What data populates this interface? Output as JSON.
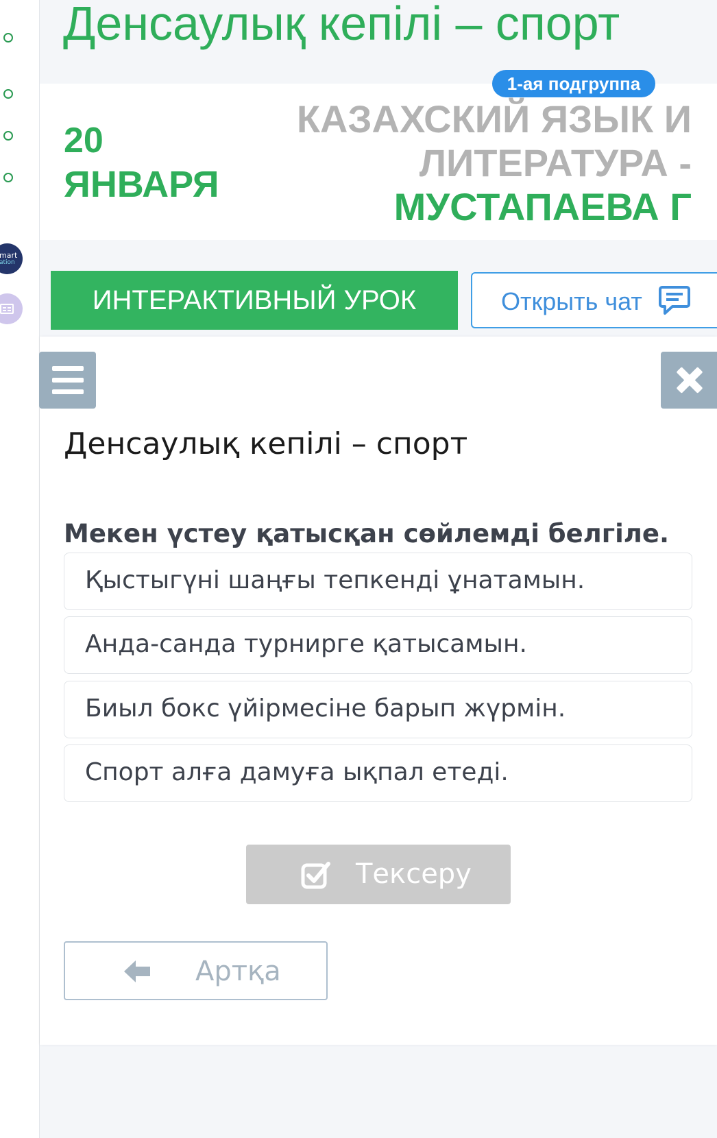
{
  "header": {
    "title": "Денсаулық кепілі – спорт"
  },
  "rail": {
    "logo_line1": "mart",
    "logo_line2": "ation"
  },
  "info": {
    "subgroup_badge": "1-ая подгруппа",
    "date_day": "20",
    "date_month": "ЯНВАРЯ",
    "subject_line1": "КАЗАХСКИЙ ЯЗЫК И",
    "subject_line2": "ЛИТЕРАТУРА -",
    "teacher": "МУСТАПАЕВА Г"
  },
  "actions": {
    "interactive_lesson": "ИНТЕРАКТИВНЫЙ УРОК",
    "open_chat": "Открыть чат"
  },
  "lesson": {
    "title": "Денсаулық кепілі – спорт",
    "question": "Мекен үстеу қатысқан сөйлемді белгіле.",
    "options": [
      "Қыстыгүні шаңғы тепкенді ұнатамын.",
      "Анда-санда турнирге қатысамын.",
      "Биыл бокс үйірмесіне барып жүрмін.",
      "Спорт алға дамуға ықпал етеді."
    ],
    "check_button": "Тексеру",
    "back_button": "Артқа"
  },
  "colors": {
    "brand_green": "#2fae5a",
    "button_green": "#33b460",
    "chat_blue": "#3f9ee6",
    "badge_blue": "#2a8ee8",
    "disabled_gray": "#cbcbcb",
    "toolbar_gray": "#9aaebd"
  },
  "icons": {
    "menu": "hamburger-icon",
    "close": "close-icon",
    "chat": "chat-bubble-icon",
    "check": "checkbox-check-icon",
    "back": "arrow-left-icon"
  }
}
